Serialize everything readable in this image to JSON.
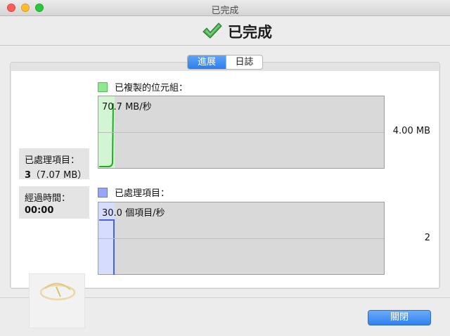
{
  "window": {
    "title": "已完成"
  },
  "header": {
    "title": "已完成",
    "icon": "checkmark-icon",
    "icon_color": "#3a9a3a"
  },
  "tabs": [
    {
      "label": "進展",
      "active": true
    },
    {
      "label": "日誌",
      "active": false
    }
  ],
  "stats": {
    "processed": {
      "label": "已處理項目：",
      "count": "3",
      "size": "（7.07 MB）"
    },
    "elapsed": {
      "label": "經過時間：",
      "value": "00:00"
    }
  },
  "graphs": {
    "bytes": {
      "legend": "已複製的位元組：",
      "rate": "70.7 MB/秒",
      "max": "4.00 MB",
      "color": "#8ee88e"
    },
    "items": {
      "legend": "已處理項目：",
      "rate": "30.0 個項目/秒",
      "max": "2",
      "color": "#98a6f6"
    }
  },
  "footer": {
    "close_label": "關閉"
  }
}
